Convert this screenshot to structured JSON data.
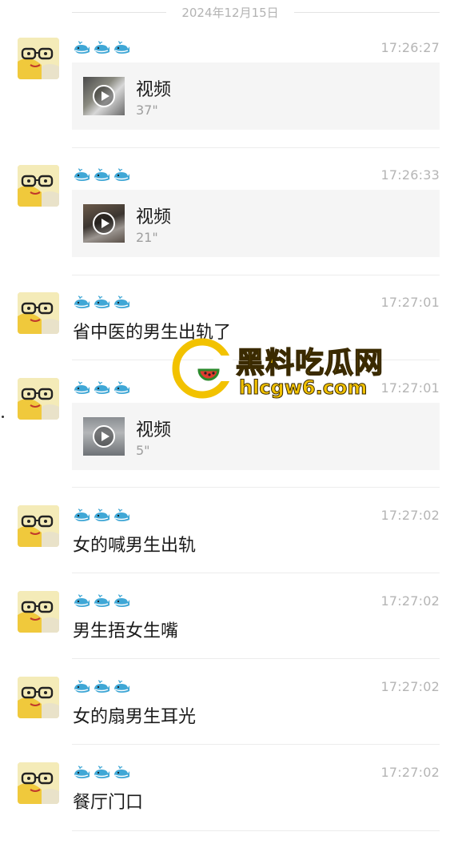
{
  "date_divider": "2024年12月15日",
  "watermark": {
    "name": "黑料吃瓜网",
    "url": "hlcgw6.com"
  },
  "messages": [
    {
      "kind": "video",
      "time": "17:26:27",
      "video": {
        "title": "视频",
        "duration": "37\""
      }
    },
    {
      "kind": "video",
      "time": "17:26:33",
      "video": {
        "title": "视频",
        "duration": "21\""
      }
    },
    {
      "kind": "text",
      "time": "17:27:01",
      "text": "省中医的男生出轨了"
    },
    {
      "kind": "video",
      "time": "17:27:01",
      "video": {
        "title": "视频",
        "duration": "5\""
      }
    },
    {
      "kind": "text",
      "time": "17:27:02",
      "text": "女的喊男生出轨"
    },
    {
      "kind": "text",
      "time": "17:27:02",
      "text": "男生捂女生嘴"
    },
    {
      "kind": "text",
      "time": "17:27:02",
      "text": "女的扇男生耳光"
    },
    {
      "kind": "text",
      "time": "17:27:02",
      "text": "餐厅门口"
    }
  ],
  "icons": {
    "sender_name": "whale-emoji",
    "video": "play-icon"
  },
  "colors": {
    "watermark": "#f2c200",
    "bubble": "#f5f5f5",
    "time": "#b5b5b5"
  }
}
